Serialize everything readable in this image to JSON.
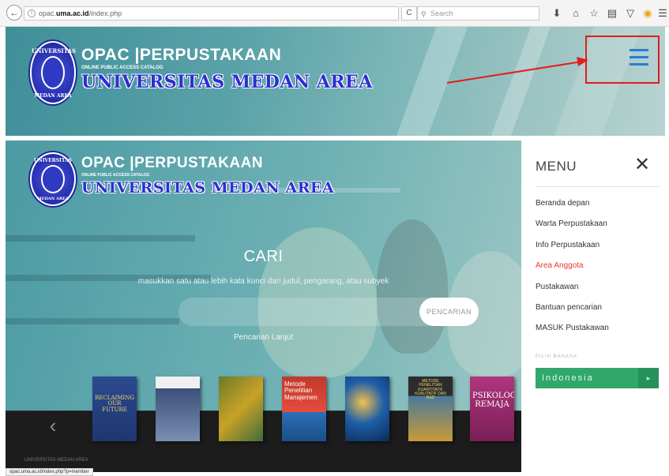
{
  "browser": {
    "url_prefix": "opac.",
    "url_domain": "uma.ac.id",
    "url_path": "/index.php",
    "search_placeholder": "Search",
    "back_glyph": "←",
    "reload_glyph": "C"
  },
  "brand": {
    "opac_title": "OPAC |PERPUSTAKAAN",
    "subtitle": "ONLINE PUBLIC ACCESS CATALOG",
    "university": "UNIVERSITAS MEDAN AREA",
    "seal_top": "UNIVERSITAS",
    "seal_bottom": "MEDAN AREA"
  },
  "search": {
    "heading": "CARI",
    "hint": "masukkan satu atau lebih kata kunci dari judul, pengarang, atau subyek",
    "button": "PENCARIAN",
    "advanced": "Pencarian Lanjut"
  },
  "books": [
    {
      "title": "RECLAIMING OUR FUTURE",
      "color": "#2b4a8f"
    },
    {
      "title": "",
      "color": "#3a4f7a"
    },
    {
      "title": "",
      "color": "#6b7a2a"
    },
    {
      "title": "Metode Penelitian Manajemen",
      "color": "#c0392b"
    },
    {
      "title": "",
      "color": "#1f5fa8"
    },
    {
      "title": "METODE PENELITIAN KUANTITATIF KUALITATIF DAN R&D",
      "color": "#2c2c2c"
    },
    {
      "title": "PSIKOLOGI REMAJA",
      "color": "#b0367d"
    }
  ],
  "carousel_prev": "‹",
  "footer": "UNIVERSITAS MEDAN AREA",
  "status_url": "opac.uma.ac.id/index.php?p=member",
  "menu": {
    "title": "MENU",
    "close": "✕",
    "items": [
      {
        "label": "Beranda depan",
        "active": false
      },
      {
        "label": "Warta Perpustakaan",
        "active": false
      },
      {
        "label": "Info Perpustakaan",
        "active": false
      },
      {
        "label": "Area Anggota",
        "active": true
      },
      {
        "label": "Pustakawan",
        "active": false
      },
      {
        "label": "Bantuan pencarian",
        "active": false
      },
      {
        "label": "MASUK Pustakawan",
        "active": false
      }
    ],
    "language_label": "PILIH BAHASA",
    "language_value": "Indonesia"
  },
  "colors": {
    "accent_green": "#2fa86a",
    "active_red": "#e53935",
    "hamburger_blue": "#2b7bd6",
    "annotation_red": "#e11d1d"
  }
}
